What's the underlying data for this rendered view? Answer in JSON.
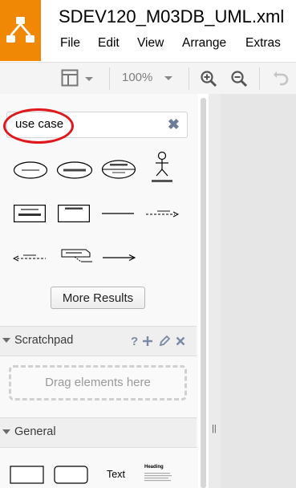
{
  "app": {
    "title": "SDEV120_M03DB_UML.xml",
    "brand_color": "#f08705",
    "logo_icon": "drawio-logo-icon"
  },
  "menu": {
    "items": [
      "File",
      "Edit",
      "View",
      "Arrange",
      "Extras"
    ]
  },
  "toolbar": {
    "zoom": "100%",
    "icons": [
      "page-view-icon",
      "zoom-in-icon",
      "zoom-out-icon",
      "undo-icon"
    ]
  },
  "search": {
    "value": "use case",
    "clear_glyph": "✖",
    "highlight_color": "#e0171b"
  },
  "results": {
    "shapes": [
      {
        "name": "use-case-ellipse",
        "label": "Use Case"
      },
      {
        "name": "use-case-name-ellipse",
        "label": "UseCaseName"
      },
      {
        "name": "use-case-extension-points-ellipse",
        "label": "UseCaseName"
      },
      {
        "name": "actor-stick-figure",
        "label": "ActorName"
      },
      {
        "name": "actor-class-box",
        "label": "ActorName",
        "stereotype": "<<Actor>>"
      },
      {
        "name": "subject-box",
        "label": "SubjectName"
      },
      {
        "name": "association-line",
        "label": ""
      },
      {
        "name": "include-dashed-arrow",
        "label": ""
      },
      {
        "name": "extend-dashed-arrow",
        "label": ""
      },
      {
        "name": "note-connector",
        "label": ""
      },
      {
        "name": "directed-association-arrow",
        "label": ""
      }
    ],
    "more_label": "More Results"
  },
  "scratchpad": {
    "title": "Scratchpad",
    "help": "?",
    "drop_text": "Drag elements here",
    "icons": [
      "help-icon",
      "add-icon",
      "edit-pencil-icon",
      "close-icon"
    ]
  },
  "general": {
    "title": "General",
    "text_shape_label": "Text",
    "heading_shape_label": "Heading"
  },
  "splitter": {
    "glyph": "||"
  }
}
